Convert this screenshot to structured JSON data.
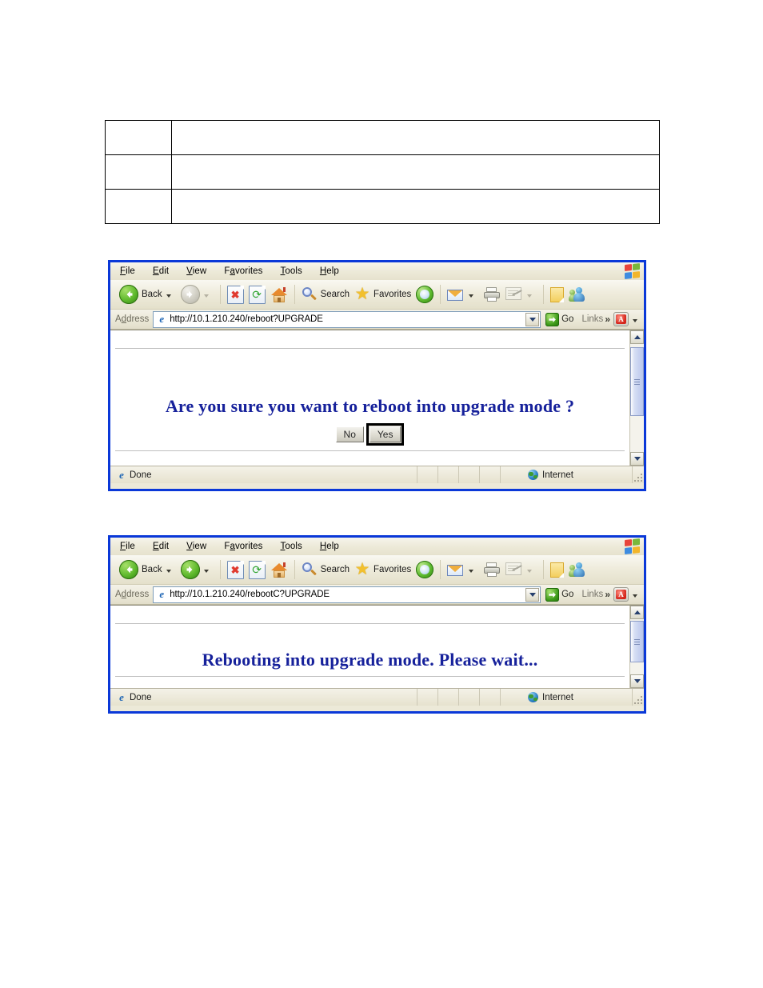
{
  "document": {
    "spec_table": {
      "rows": [
        {
          "label": "",
          "value": ""
        },
        {
          "label": "",
          "value": ""
        },
        {
          "label": "",
          "value": ""
        }
      ]
    }
  },
  "colors": {
    "window_border": "#0A38D8",
    "heading_text": "#16219B",
    "toolbar_bg": "#ECE9D8",
    "page_bg": "#FFFFFF"
  },
  "browser_windows": [
    {
      "name": "reboot-confirm-window",
      "menu": {
        "items": [
          {
            "label": "File",
            "accel": "F"
          },
          {
            "label": "Edit",
            "accel": "E"
          },
          {
            "label": "View",
            "accel": "V"
          },
          {
            "label": "Favorites",
            "accel": "a"
          },
          {
            "label": "Tools",
            "accel": "T"
          },
          {
            "label": "Help",
            "accel": "H"
          }
        ],
        "logo": "windows-flag-icon"
      },
      "toolbar": {
        "back_label": "Back",
        "back_icon": "back-arrow-icon",
        "back_enabled": true,
        "forward_icon": "forward-arrow-icon",
        "forward_enabled": false,
        "stop_icon": "stop-icon",
        "refresh_icon": "refresh-icon",
        "home_icon": "home-icon",
        "search_label": "Search",
        "search_icon": "search-icon",
        "favorites_label": "Favorites",
        "favorites_icon": "star-icon",
        "media_icon": "media-icon",
        "mail_icon": "mail-icon",
        "print_icon": "print-icon",
        "edit_icon": "edit-icon",
        "edit_enabled": false,
        "note_icon": "note-icon",
        "messenger_icon": "messenger-icon"
      },
      "address_bar": {
        "label": "Address",
        "label_accel": "d",
        "url": "http://10.1.210.240/reboot?UPGRADE",
        "favicon": "ie-page-icon",
        "dropdown_icon": "chevron-down-icon",
        "go_label": "Go",
        "go_icon": "go-arrow-icon",
        "links_label": "Links",
        "links_overflow_icon": "double-chevron-icon",
        "pdf_icon": "adobe-pdf-icon"
      },
      "page": {
        "heading": "Are you sure you want to reboot into upgrade mode ?",
        "buttons": [
          {
            "label": "No",
            "focused": false
          },
          {
            "label": "Yes",
            "focused": true
          }
        ]
      },
      "status_bar": {
        "text": "Done",
        "icon": "ie-page-icon",
        "zone": "Internet",
        "zone_icon": "globe-icon"
      },
      "scrollbar": {
        "up_icon": "scroll-up-icon",
        "down_icon": "scroll-down-icon"
      }
    },
    {
      "name": "rebooting-window",
      "menu": {
        "items": [
          {
            "label": "File",
            "accel": "F"
          },
          {
            "label": "Edit",
            "accel": "E"
          },
          {
            "label": "View",
            "accel": "V"
          },
          {
            "label": "Favorites",
            "accel": "a"
          },
          {
            "label": "Tools",
            "accel": "T"
          },
          {
            "label": "Help",
            "accel": "H"
          }
        ],
        "logo": "windows-flag-icon"
      },
      "toolbar": {
        "back_label": "Back",
        "back_icon": "back-arrow-icon",
        "back_enabled": true,
        "forward_icon": "forward-arrow-icon",
        "forward_enabled": true,
        "stop_icon": "stop-icon",
        "refresh_icon": "refresh-icon",
        "home_icon": "home-icon",
        "search_label": "Search",
        "search_icon": "search-icon",
        "favorites_label": "Favorites",
        "favorites_icon": "star-icon",
        "media_icon": "media-icon",
        "mail_icon": "mail-icon",
        "print_icon": "print-icon",
        "edit_icon": "edit-icon",
        "edit_enabled": false,
        "note_icon": "note-icon",
        "messenger_icon": "messenger-icon"
      },
      "address_bar": {
        "label": "Address",
        "label_accel": "d",
        "url": "http://10.1.210.240/rebootC?UPGRADE",
        "favicon": "ie-page-icon",
        "dropdown_icon": "chevron-down-icon",
        "go_label": "Go",
        "go_icon": "go-arrow-icon",
        "links_label": "Links",
        "links_overflow_icon": "double-chevron-icon",
        "pdf_icon": "adobe-pdf-icon"
      },
      "page": {
        "heading": "Rebooting into upgrade mode. Please wait...",
        "buttons": []
      },
      "status_bar": {
        "text": "Done",
        "icon": "ie-page-icon",
        "zone": "Internet",
        "zone_icon": "globe-icon"
      },
      "scrollbar": {
        "up_icon": "scroll-up-icon",
        "down_icon": "scroll-down-icon"
      }
    }
  ]
}
